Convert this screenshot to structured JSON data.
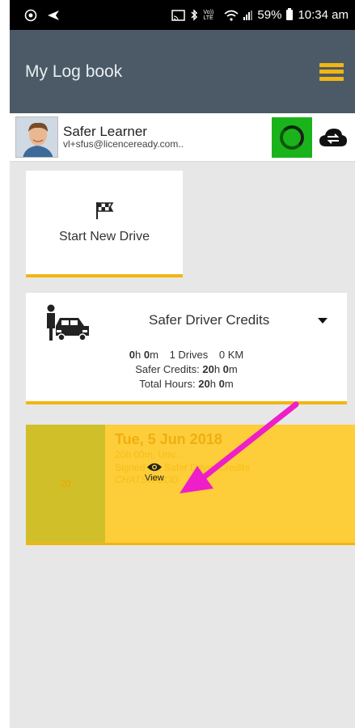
{
  "status_bar": {
    "left_icons": [
      "camera-icon",
      "send-icon"
    ],
    "right_icons": [
      "cast-icon",
      "bluetooth-icon",
      "volte-icon",
      "wifi-icon",
      "signal-icon",
      "battery-icon"
    ],
    "volte_text": "Vo)) LTE",
    "battery": "59%",
    "time": "10:34 am"
  },
  "app_bar": {
    "title": "My Log book",
    "menu_icon": "hamburger-menu-icon"
  },
  "user": {
    "name": "Safer Learner",
    "email": "vl+sfus@licenceready.com..",
    "status_color": "#1bb31b"
  },
  "start_drive": {
    "icon": "checkered-flag-icon",
    "label": "Start New Drive"
  },
  "credits": {
    "title": "Safer Driver Credits",
    "hours_value": "0",
    "hours_unit": "h",
    "minutes_value": "0",
    "minutes_unit": "m",
    "drives": "1 Drives",
    "km": "0 KM",
    "safer_label": "Safer Credits:",
    "safer_h": "20",
    "safer_h_unit": "h",
    "safer_m": "0",
    "safer_m_unit": "m",
    "total_label": "Total Hours:",
    "total_h": "20",
    "total_h_unit": "h",
    "total_m": "0",
    "total_m_unit": "m"
  },
  "drive_entry": {
    "side_label": "20",
    "date": "Tue, 5 Jun 2018",
    "duration": "20h 00m, Unv...",
    "signed": "Signed-off, Safer Driver Credits",
    "location": "CHATSWOOD",
    "view_label": "View"
  },
  "colors": {
    "app_bar": "#4b5a66",
    "accent": "#f2b612",
    "entry_bg": "#fdcd3a",
    "entry_side": "#d1bf2a",
    "annotation_arrow": "#ee1ec8"
  }
}
